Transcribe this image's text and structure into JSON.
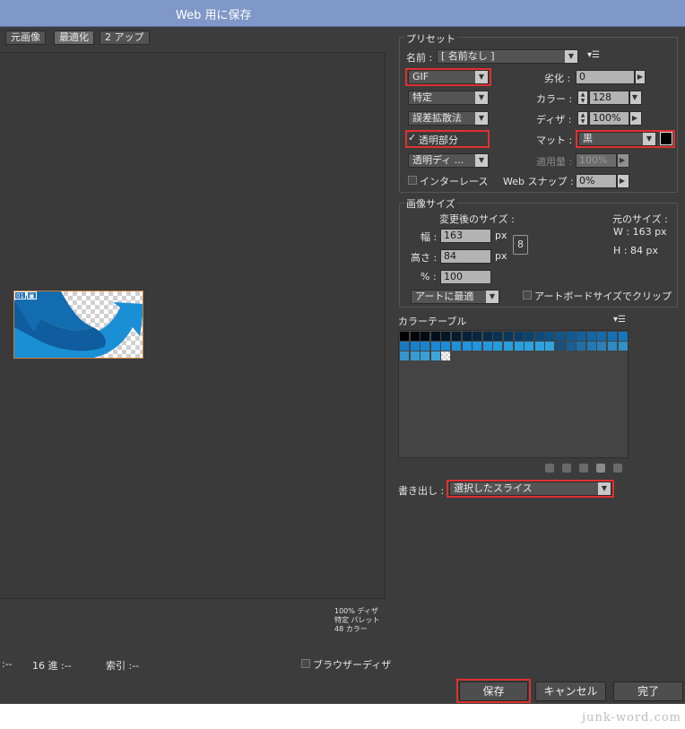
{
  "window": {
    "title": "Web 用に保存"
  },
  "tabs": [
    "元画像",
    "最適化",
    "2 アップ"
  ],
  "canvas": {
    "slice_badge": "01",
    "info_lines": [
      "100% ディザ",
      "特定 パレット",
      "48 カラー"
    ]
  },
  "statusbar": {
    "left": ":--",
    "hex": "16 進 :--",
    "index": "索引 :--",
    "browser_dither_label": "ブラウザーディザ"
  },
  "preset": {
    "group_label": "プリセット",
    "name_label": "名前 :",
    "name_value": "[ 名前なし ]",
    "format": "GIF",
    "reduction": "特定",
    "dither_algo": "誤差拡散法",
    "transparency_label": "透明部分",
    "transparency_checked": true,
    "transparency_dither": "透明ディ ...",
    "interlace_label": "インターレース",
    "lossy_label": "劣化 :",
    "lossy_value": "0",
    "colors_label": "カラー :",
    "colors_value": "128",
    "dither_label": "ディザ :",
    "dither_value": "100%",
    "matte_label": "マット :",
    "matte_value": "黒",
    "matte_color": "#000000",
    "amount_label": "適用量 :",
    "amount_value": "100%",
    "websnap_label": "Web スナップ :",
    "websnap_value": "0%"
  },
  "image_size": {
    "group_label": "画像サイズ",
    "new_size_label": "変更後のサイズ :",
    "width_label": "幅 :",
    "width_value": "163",
    "height_label": "高さ :",
    "height_value": "84",
    "percent_label": "% :",
    "percent_value": "100",
    "unit": "px",
    "orig_label": "元のサイズ :",
    "orig_w": "W : 163 px",
    "orig_h": "H : 84 px",
    "quality": "アートに最適",
    "clip_label": "アートボードサイズでクリップ"
  },
  "color_table": {
    "label": "カラーテーブル",
    "colors": [
      "#000000",
      "#01060c",
      "#020b14",
      "#03101c",
      "#041626",
      "#051b2f",
      "#062138",
      "#072741",
      "#082c4a",
      "#093253",
      "#0a385c",
      "#0b3e66",
      "#0c446f",
      "#0d4a78",
      "#0e5081",
      "#0f568b",
      "#105b94",
      "#11619c",
      "#1266a5",
      "#136cad",
      "#1471b5",
      "#1576bc",
      "#167bc3",
      "#1780c9",
      "#1884ce",
      "#1a88d2",
      "#1c8cd5",
      "#1e90d8",
      "#2093da",
      "#2296dc",
      "#2498dd",
      "#269bde",
      "#289ddf",
      "#2a9fe0",
      "#2ca1e0",
      "#2ea2e1",
      "#30a4e1",
      "#1b4f7c",
      "#1a5f94",
      "#1e6fa8",
      "#2379b4",
      "#2a81bc",
      "#2f8ac3",
      "#3190c9",
      "#3596cd",
      "#389bd1",
      "#3b9fd4",
      "#3fa3d7"
    ]
  },
  "export": {
    "label": "書き出し :",
    "value": "選択したスライス"
  },
  "buttons": {
    "save": "保存",
    "cancel": "キャンセル",
    "done": "完了"
  },
  "watermark": "junk-word.com"
}
